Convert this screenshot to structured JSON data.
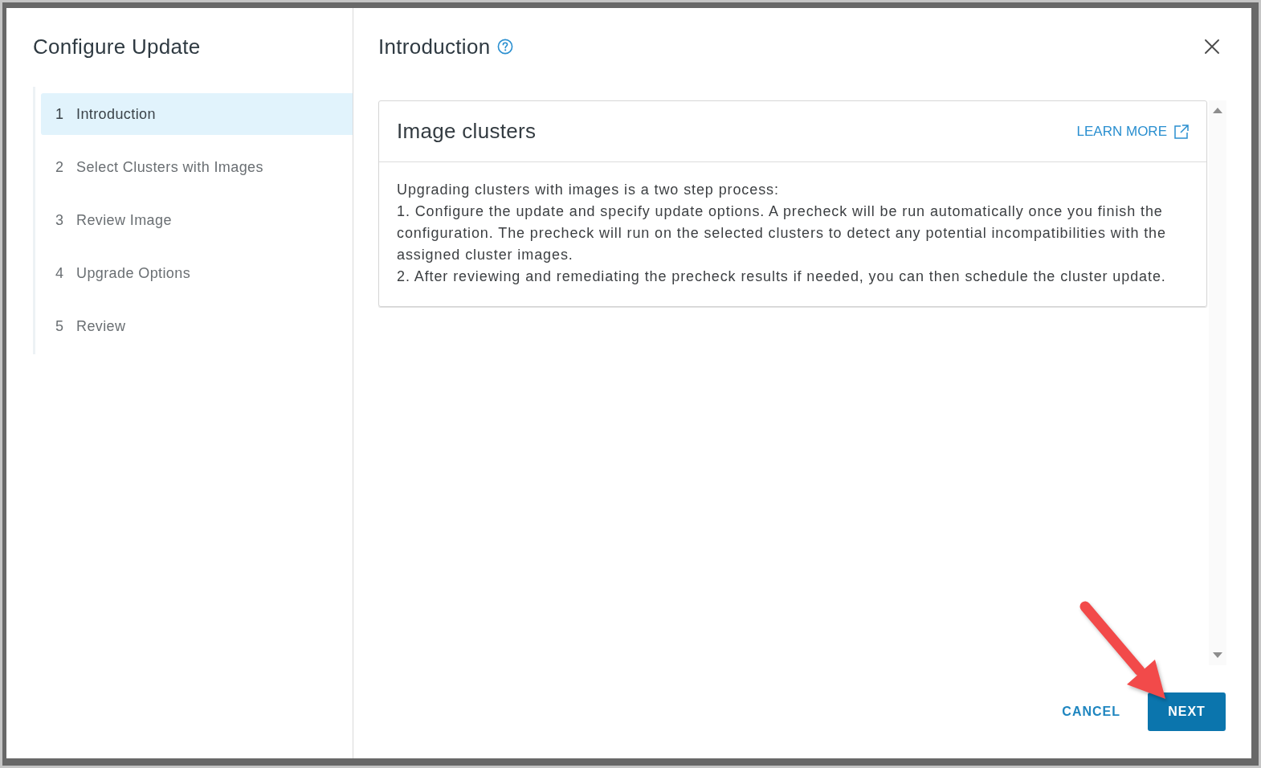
{
  "sidebar": {
    "title": "Configure Update",
    "steps": [
      {
        "number": "1",
        "label": "Introduction",
        "selected": true
      },
      {
        "number": "2",
        "label": "Select Clusters with Images",
        "selected": false
      },
      {
        "number": "3",
        "label": "Review Image",
        "selected": false
      },
      {
        "number": "4",
        "label": "Upgrade Options",
        "selected": false
      },
      {
        "number": "5",
        "label": "Review",
        "selected": false
      }
    ]
  },
  "main": {
    "title": "Introduction",
    "card": {
      "title": "Image clusters",
      "link": "LEARN MORE",
      "paragraphs": [
        "Upgrading clusters with images is a two step process:",
        "1. Configure the update and specify update options. A precheck will be run automatically once you finish the configuration. The precheck will run on the selected clusters to detect any potential incompatibilities with the assigned cluster images.",
        "2. After reviewing and remediating the precheck results if needed, you can then schedule the cluster update."
      ]
    },
    "buttons": [
      {
        "label": "CANCEL",
        "kind": "flat"
      },
      {
        "label": "NEXT",
        "kind": "primary"
      }
    ]
  },
  "annotations": [
    {
      "kind": "arrow"
    }
  ]
}
